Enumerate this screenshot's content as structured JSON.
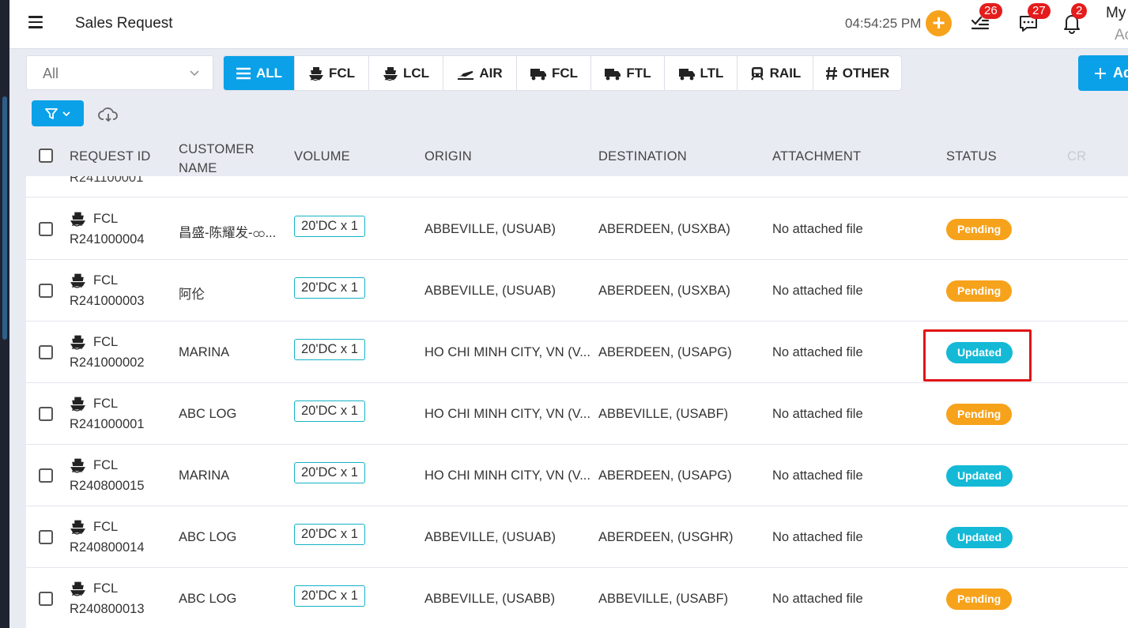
{
  "header": {
    "title": "Sales Request",
    "clock": "04:54:25 PM",
    "tasks_badge": "26",
    "messages_badge": "27",
    "notifications_badge": "2",
    "user_name": "My",
    "user_role": "Ac"
  },
  "filters": {
    "select_value": "All",
    "tabs": [
      {
        "label": "ALL",
        "icon": "list-icon",
        "active": true
      },
      {
        "label": "FCL",
        "icon": "ship-icon"
      },
      {
        "label": "LCL",
        "icon": "ship-icon"
      },
      {
        "label": "AIR",
        "icon": "plane-icon"
      },
      {
        "label": "FCL",
        "icon": "truck-icon"
      },
      {
        "label": "FTL",
        "icon": "truck-icon"
      },
      {
        "label": "LTL",
        "icon": "truck-icon"
      },
      {
        "label": "RAIL",
        "icon": "train-icon"
      },
      {
        "label": "OTHER",
        "icon": "hash-icon"
      }
    ],
    "add_label": "Ad"
  },
  "table": {
    "columns": {
      "request_id": "REQUEST ID",
      "customer_name": "CUSTOMER NAME",
      "volume": "VOLUME",
      "origin": "ORIGIN",
      "destination": "DESTINATION",
      "attachment": "ATTACHMENT",
      "status": "STATUS",
      "cr": "CR"
    },
    "partial_row_id": "R241100001",
    "rows": [
      {
        "type": "FCL",
        "id": "R241000004",
        "customer": "昌盛-陈耀发-ထ...",
        "volume": "20'DC x 1",
        "origin": "ABBEVILLE, (USUAB)",
        "destination": "ABERDEEN, (USXBA)",
        "attachment": "No attached file",
        "status": "Pending"
      },
      {
        "type": "FCL",
        "id": "R241000003",
        "customer": "阿伦",
        "volume": "20'DC x 1",
        "origin": "ABBEVILLE, (USUAB)",
        "destination": "ABERDEEN, (USXBA)",
        "attachment": "No attached file",
        "status": "Pending"
      },
      {
        "type": "FCL",
        "id": "R241000002",
        "customer": "MARINA",
        "volume": "20'DC x 1",
        "origin": "HO CHI MINH CITY, VN (V...",
        "destination": "ABERDEEN, (USAPG)",
        "attachment": "No attached file",
        "status": "Updated"
      },
      {
        "type": "FCL",
        "id": "R241000001",
        "customer": "ABC LOG",
        "volume": "20'DC x 1",
        "origin": "HO CHI MINH CITY, VN (V...",
        "destination": "ABBEVILLE, (USABF)",
        "attachment": "No attached file",
        "status": "Pending"
      },
      {
        "type": "FCL",
        "id": "R240800015",
        "customer": "MARINA",
        "volume": "20'DC x 1",
        "origin": "HO CHI MINH CITY, VN (V...",
        "destination": "ABERDEEN, (USAPG)",
        "attachment": "No attached file",
        "status": "Updated"
      },
      {
        "type": "FCL",
        "id": "R240800014",
        "customer": "ABC LOG",
        "volume": "20'DC x 1",
        "origin": "ABBEVILLE, (USUAB)",
        "destination": "ABERDEEN, (USGHR)",
        "attachment": "No attached file",
        "status": "Updated"
      },
      {
        "type": "FCL",
        "id": "R240800013",
        "customer": "ABC LOG",
        "volume": "20'DC x 1",
        "origin": "ABBEVILLE, (USABB)",
        "destination": "ABBEVILLE, (USABF)",
        "attachment": "No attached file",
        "status": "Pending"
      }
    ]
  },
  "colors": {
    "accent": "#0aa1e8",
    "pending": "#f7a21b",
    "updated": "#14b9d6",
    "highlight": "#e01414"
  }
}
